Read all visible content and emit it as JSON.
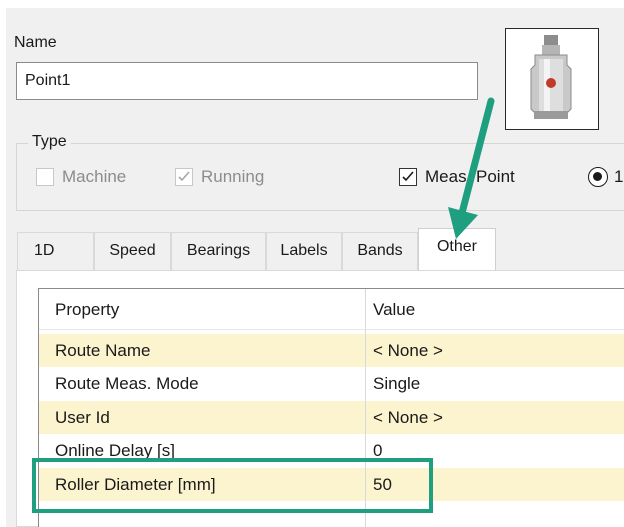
{
  "name_label": "Name",
  "name_value": "Point1",
  "type_label": "Type",
  "checkboxes": [
    {
      "label": "Machine",
      "checked": false,
      "enabled": false
    },
    {
      "label": "Running",
      "checked": true,
      "enabled": false
    },
    {
      "label": "Meas. Point",
      "checked": true,
      "enabled": true
    }
  ],
  "radio_label": "1",
  "tabs": [
    "1D",
    "Speed",
    "Bearings",
    "Labels",
    "Bands",
    "Other"
  ],
  "active_tab": "Other",
  "grid": {
    "headers": [
      "Property",
      "Value"
    ],
    "rows": [
      {
        "property": "Route Name",
        "value": "< None >"
      },
      {
        "property": "Route Meas. Mode",
        "value": "Single"
      },
      {
        "property": "User Id",
        "value": "< None >"
      },
      {
        "property": "Online Delay [s]",
        "value": "0"
      },
      {
        "property": "Roller Diameter [mm]",
        "value": "50"
      }
    ]
  },
  "colors": {
    "callout": "#1f9e80",
    "row_highlight": "#fcf3cf"
  },
  "icons": [
    "sensor-image",
    "checkmark-icon",
    "radio-selected-icon",
    "callout-arrow-icon"
  ]
}
